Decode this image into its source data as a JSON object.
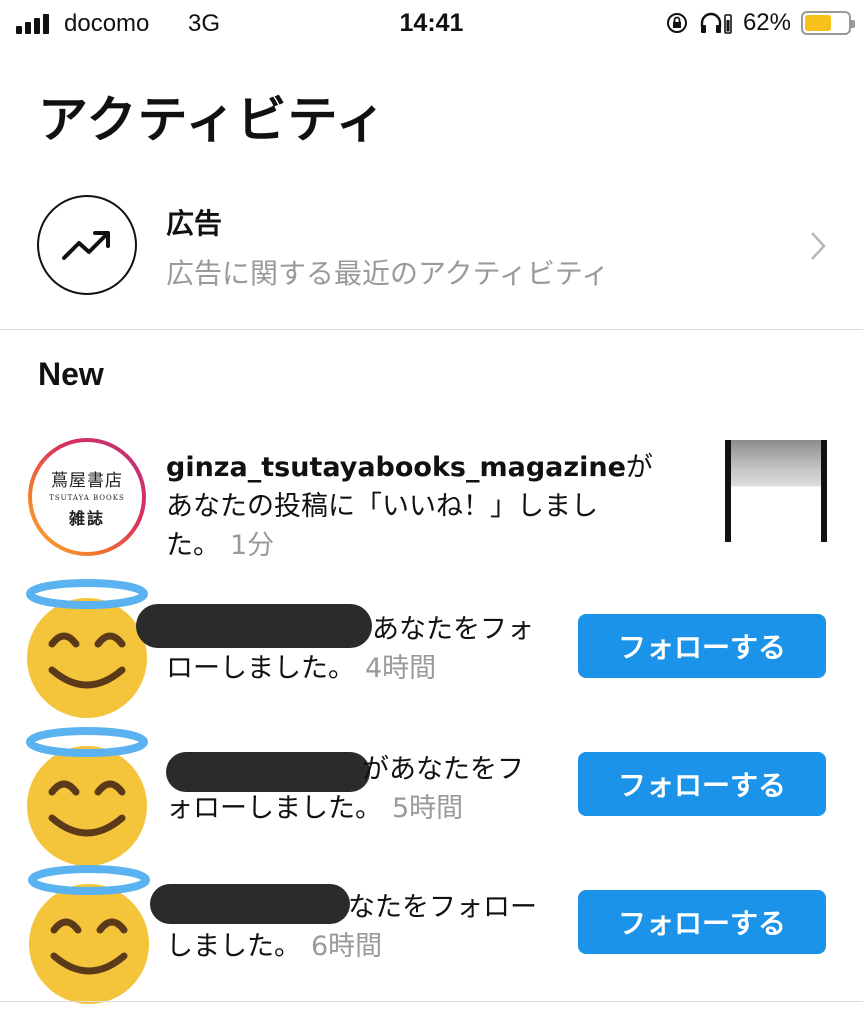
{
  "status_bar": {
    "carrier": "docomo",
    "network": "3G",
    "time": "14:41",
    "battery_percent": "62%",
    "battery_level": 0.62,
    "icons": [
      "signal-icon",
      "rotation-lock-icon",
      "headphones-icon",
      "battery-icon"
    ],
    "battery_color": "#f6c11b"
  },
  "header": {
    "title": "アクティビティ"
  },
  "ads": {
    "icon": "trending-up-icon",
    "title": "広告",
    "subtitle": "広告に関する最近のアクティビティ"
  },
  "section": {
    "title": "New"
  },
  "notifications": [
    {
      "username": "ginza_tsutayabooks_magazine",
      "message_line1_suffix": "が",
      "message_line2": "あなたの投稿に「いいね！」しまし",
      "message_line3": "た。",
      "time": "1分",
      "avatar_logo": {
        "line1": "蔦屋書店",
        "line2": "TSUTAYA BOOKS",
        "line3": "雑誌"
      }
    },
    {
      "message_line1": "あなたをフォ",
      "message_line2": "ローしました。",
      "time": "4時間",
      "button_label": "フォローする"
    },
    {
      "message_line1": "があなたをフ",
      "message_line2": "ォローしました。",
      "time": "5時間",
      "button_label": "フォローする"
    },
    {
      "message_line1": "なたをフォロー",
      "message_line2": "しました。",
      "time": "6時間",
      "button_label": "フォローする"
    }
  ],
  "colors": {
    "follow_button": "#1a93e8",
    "secondary_text": "#9a9a9a",
    "emoji_face": "#f4c43a",
    "halo": "#5ab3f0"
  }
}
